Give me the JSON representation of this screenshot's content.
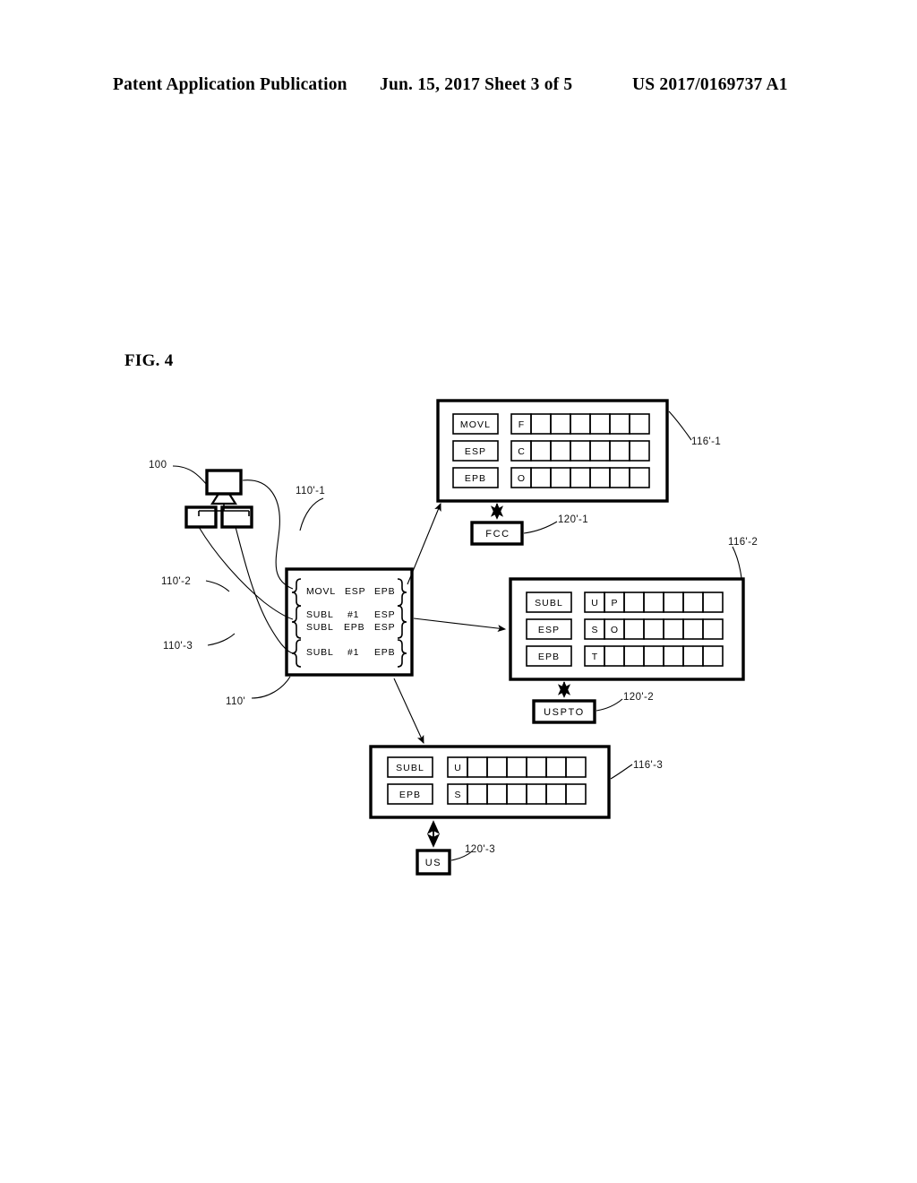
{
  "header": {
    "publication": "Patent Application Publication",
    "date_sheet": "Jun. 15, 2017  Sheet 3 of 5",
    "patent_number": "US 2017/0169737 A1"
  },
  "figure": {
    "caption": "FIG. 4"
  },
  "source": {
    "ref": "100",
    "icon": "network-computers-icon"
  },
  "code_box": {
    "ref": "110'",
    "groups": [
      {
        "ref": "110'-1",
        "lines": [
          {
            "op": "MOVL",
            "arg1": "ESP",
            "arg2": "EPB"
          }
        ]
      },
      {
        "ref": "110'-2",
        "lines": [
          {
            "op": "SUBL",
            "arg1": "#1",
            "arg2": "ESP"
          },
          {
            "op": "SUBL",
            "arg1": "EPB",
            "arg2": "ESP"
          }
        ]
      },
      {
        "ref": "110'-3",
        "lines": [
          {
            "op": "SUBL",
            "arg1": "#1",
            "arg2": "EPB"
          }
        ]
      }
    ]
  },
  "blocks": [
    {
      "ref": "116'-1",
      "agency": {
        "ref": "120'-1",
        "label": "FCC"
      },
      "rows": [
        {
          "label": "MOVL",
          "cells": [
            "F",
            "",
            "",
            "",
            "",
            "",
            "",
            ""
          ]
        },
        {
          "label": "ESP",
          "cells": [
            "C",
            "",
            "",
            "",
            "",
            "",
            "",
            ""
          ]
        },
        {
          "label": "EPB",
          "cells": [
            "O",
            "",
            "",
            "",
            "",
            "",
            "",
            ""
          ]
        }
      ]
    },
    {
      "ref": "116'-2",
      "agency": {
        "ref": "120'-2",
        "label": "USPTO"
      },
      "rows": [
        {
          "label": "SUBL",
          "cells": [
            "U",
            "P",
            "",
            "",
            "",
            "",
            "",
            ""
          ]
        },
        {
          "label": "ESP",
          "cells": [
            "S",
            "O",
            "",
            "",
            "",
            "",
            "",
            ""
          ]
        },
        {
          "label": "EPB",
          "cells": [
            "T",
            "",
            "",
            "",
            "",
            "",
            "",
            ""
          ]
        }
      ]
    },
    {
      "ref": "116'-3",
      "agency": {
        "ref": "120'-3",
        "label": "US"
      },
      "rows": [
        {
          "label": "SUBL",
          "cells": [
            "U",
            "",
            "",
            "",
            "",
            "",
            "",
            ""
          ]
        },
        {
          "label": "EPB",
          "cells": [
            "S",
            "",
            "",
            "",
            "",
            "",
            "",
            ""
          ]
        }
      ]
    }
  ]
}
